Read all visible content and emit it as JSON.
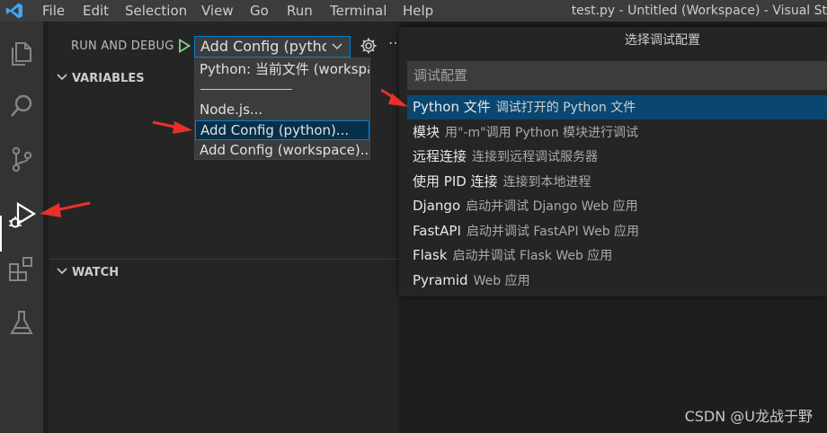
{
  "menubar": {
    "items": [
      "File",
      "Edit",
      "Selection",
      "View",
      "Go",
      "Run",
      "Terminal",
      "Help"
    ],
    "window_title": "test.py - Untitled (Workspace) - Visual St"
  },
  "activity_bar": {
    "icons": [
      "files-icon",
      "search-icon",
      "source-control-icon",
      "run-debug-icon",
      "extensions-icon",
      "testing-icon"
    ],
    "active": "run-debug-icon"
  },
  "debug_panel": {
    "header": "RUN AND DEBUG",
    "config_value": "Add Config (python",
    "sections": {
      "variables": "VARIABLES",
      "watch": "WATCH"
    }
  },
  "config_dropdown": {
    "options": [
      "Python: 当前文件 (workspa",
      "Node.js...",
      "Add Config (python)...",
      "Add Config (workspace)..."
    ],
    "selected_index": 2
  },
  "quick_pick": {
    "title": "选择调试配置",
    "placeholder": "调试配置",
    "items": [
      {
        "label": "Python 文件",
        "desc": "调试打开的 Python 文件"
      },
      {
        "label": "模块",
        "desc": "用\"-m\"调用 Python 模块进行调试"
      },
      {
        "label": "远程连接",
        "desc": "连接到远程调试服务器"
      },
      {
        "label": "使用 PID 连接",
        "desc": "连接到本地进程"
      },
      {
        "label": "Django",
        "desc": "启动并调试 Django Web 应用"
      },
      {
        "label": "FastAPI",
        "desc": "启动并调试 FastAPI Web 应用"
      },
      {
        "label": "Flask",
        "desc": "启动并调试 Flask Web 应用"
      },
      {
        "label": "Pyramid",
        "desc": "Web 应用"
      }
    ],
    "active_index": 0
  },
  "watermark": "CSDN @U龙战于野",
  "colors": {
    "accent": "#007fd4",
    "selection": "#094771",
    "annotation_arrow": "#e8302a",
    "run_icon_green": "#89d185"
  }
}
